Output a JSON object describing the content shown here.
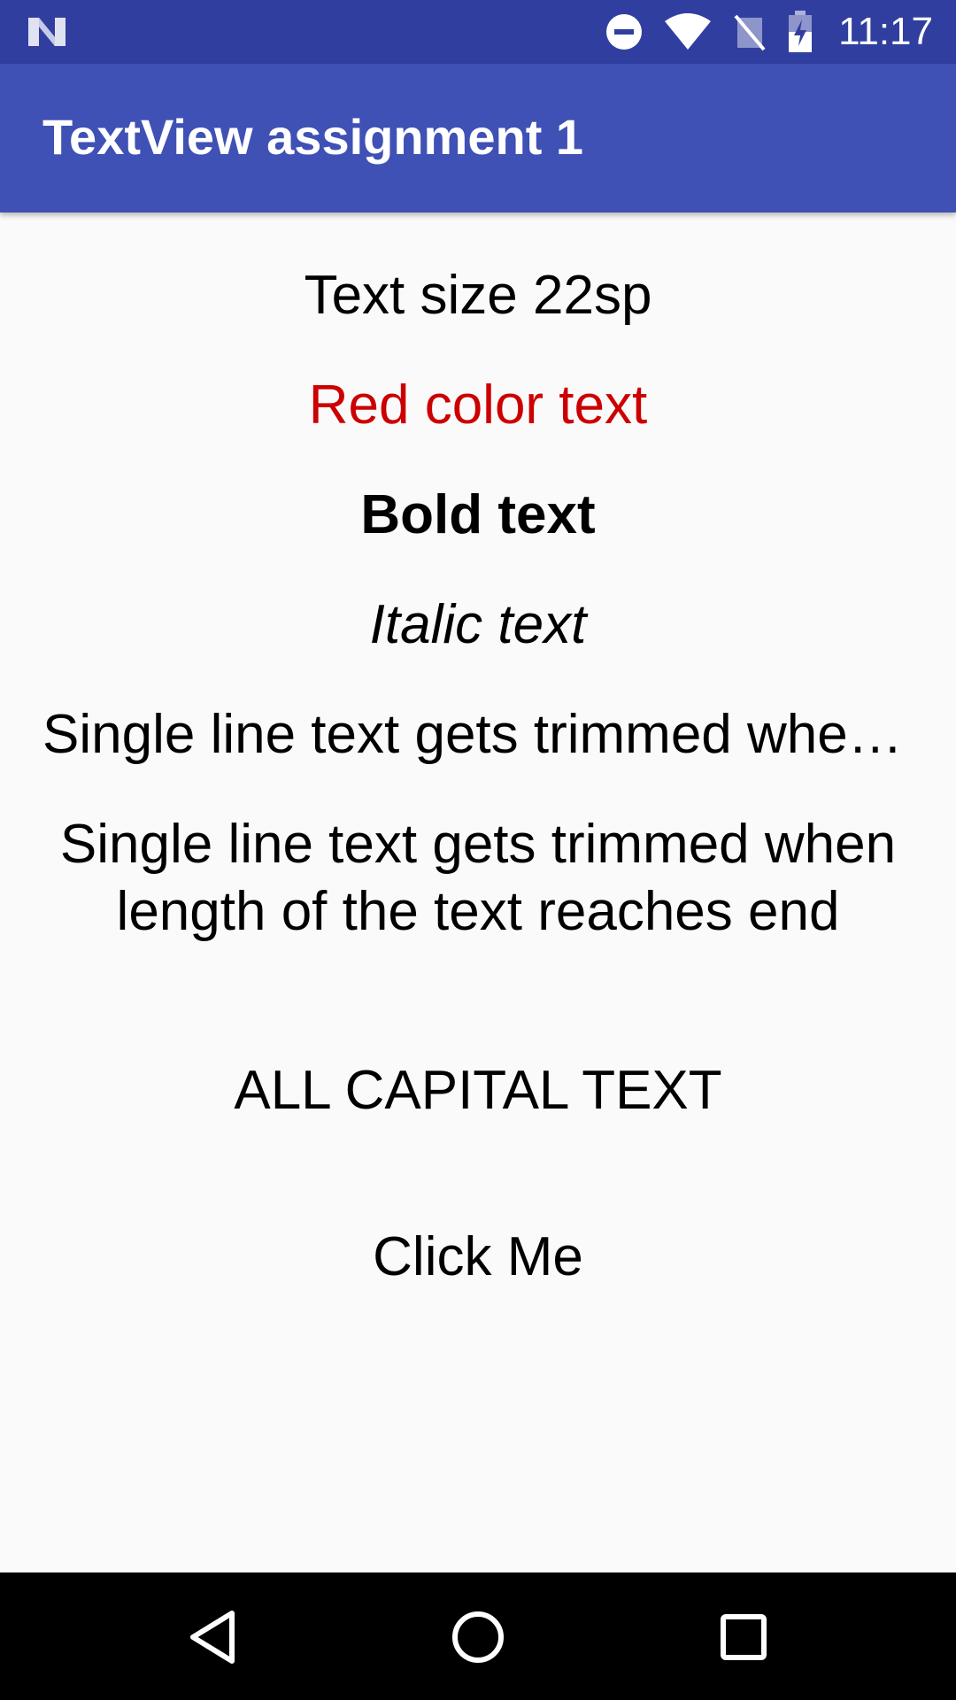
{
  "status_bar": {
    "time": "11:17",
    "icons": [
      "notification-n-icon",
      "do-not-disturb-icon",
      "wifi-icon",
      "no-signal-icon",
      "battery-charging-icon"
    ],
    "background_color": "#303f9f"
  },
  "app_bar": {
    "title": "TextView assignment 1",
    "background_color": "#3f51b5"
  },
  "content": {
    "text_size": "Text size 22sp",
    "red_text": "Red color text",
    "red_color": "#cc0000",
    "bold_text": "Bold text",
    "italic_text": "Italic text",
    "single_line_text": "Single line text gets trimmed when length of the text reaches end",
    "multi_line_text": "Single line text gets trimmed when length of the text reaches end",
    "caps_text": "All capital text",
    "button_label": "Click Me"
  },
  "nav_bar": {
    "icons": [
      "back-icon",
      "home-icon",
      "recents-icon"
    ]
  }
}
